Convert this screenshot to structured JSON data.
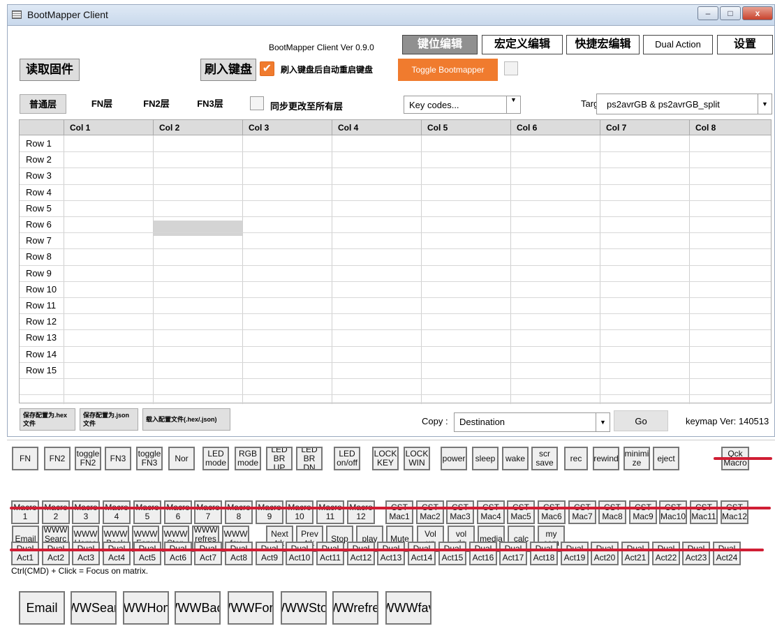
{
  "window": {
    "title": "BootMapper Client",
    "minimize": "–",
    "maximize": "□",
    "close": "x"
  },
  "version": "BootMapper Client Ver 0.9.0",
  "tabs": [
    "键位编辑",
    "宏定义编辑",
    "快捷宏编辑",
    "Dual Action",
    "设置"
  ],
  "toolbar": {
    "read_fw": "读取固件",
    "flash": "刷入键盘",
    "auto_restart_checked": true,
    "auto_restart_label": "刷入键盘后自动重启键盘",
    "toggle_bootmapper": "Toggle Bootmapper"
  },
  "layers": [
    "普通层",
    "FN层",
    "FN2层",
    "FN3层"
  ],
  "sync_label": "同步更改至所有层",
  "keycodes": "Key codes...",
  "target_label": "Target :",
  "target_value": "ps2avrGB & ps2avrGB_split",
  "grid": {
    "columns": [
      "Col 1",
      "Col 2",
      "Col 3",
      "Col 4",
      "Col 5",
      "Col 6",
      "Col 7",
      "Col 8"
    ],
    "rows": [
      "Row 1",
      "Row 2",
      "Row 3",
      "Row 4",
      "Row 5",
      "Row 6",
      "Row 7",
      "Row 8",
      "Row 9",
      "Row 10",
      "Row 11",
      "Row 12",
      "Row 13",
      "Row 14",
      "Row 15"
    ]
  },
  "bottom": {
    "save_hex": [
      "保存配置为.hex",
      "文件"
    ],
    "save_json": [
      "保存配置为.json",
      "文件"
    ],
    "load": "载入配置文件(.hex/.json)",
    "copy_label": "Copy :",
    "destination": "Destination",
    "go": "Go",
    "keymap_ver": "keymap Ver: 140513"
  },
  "keys_row1": [
    "FN",
    "FN2",
    "toggle|FN2",
    "FN3",
    "toggle|FN3",
    "Nor",
    "LED|mode",
    "RGB|mode",
    "LED|BR UP",
    "LED|BR DN",
    "LED|on/off",
    "LOCK|KEY",
    "LOCK|WIN",
    "power",
    "sleep",
    "wake",
    "scr|save",
    "rec",
    "rewind",
    "minimi|ze",
    "eject",
    "Qck|Macro"
  ],
  "keys_row2": [
    "Macro|1",
    "Macro|2",
    "Macro|3",
    "Macro|4",
    "Macro|5",
    "Macro|6",
    "Macro|7",
    "Macro|8",
    "Macro|9",
    "Macro|10",
    "Macro|11",
    "Macro|12",
    "CST|Mac1",
    "CST|Mac2",
    "CST|Mac3",
    "CST|Mac4",
    "CST|Mac5",
    "CST|Mac6",
    "CST|Mac7",
    "CST|Mac8",
    "CST|Mac9",
    "CST|Mac10",
    "CST|Mac11",
    "CST|Mac12"
  ],
  "keys_row3": [
    "Email",
    "WWW|Searc|h",
    "WWW|Home",
    "WWW|Back",
    "WWW|Forw",
    "WWW|Stop",
    "WWW|refres|h",
    "WWW|fav",
    "Next|trk",
    "Prev|trk",
    "Stop",
    "play",
    "Mute",
    "Vol|up",
    "vol|dn",
    "media",
    "calc",
    "my|com"
  ],
  "keys_row4": [
    "Dual|Act1",
    "Dual|Act2",
    "Dual|Act3",
    "Dual|Act4",
    "Dual|Act5",
    "Dual|Act6",
    "Dual|Act7",
    "Dual|Act8",
    "Dual|Act9",
    "Dual|Act10",
    "Dual|Act11",
    "Dual|Act12",
    "Dual|Act13",
    "Dual|Act14",
    "Dual|Act15",
    "Dual|Act16",
    "Dual|Act17",
    "Dual|Act18",
    "Dual|Act19",
    "Dual|Act20",
    "Dual|Act21",
    "Dual|Act22",
    "Dual|Act23",
    "Dual|Act24"
  ],
  "hint": "Ctrl(CMD) + Click = Focus on matrix.",
  "zoom_keys": [
    "Email",
    "WWW|Searc|h",
    "WWW|Home",
    "WWW|Back",
    "WWW|Forw",
    "WWW|Stop",
    "WWW|refres|h",
    "WWW|fav"
  ],
  "colors": {
    "accent": "#f07b2e",
    "tab_active": "#909090",
    "strike": "#d01e34"
  }
}
